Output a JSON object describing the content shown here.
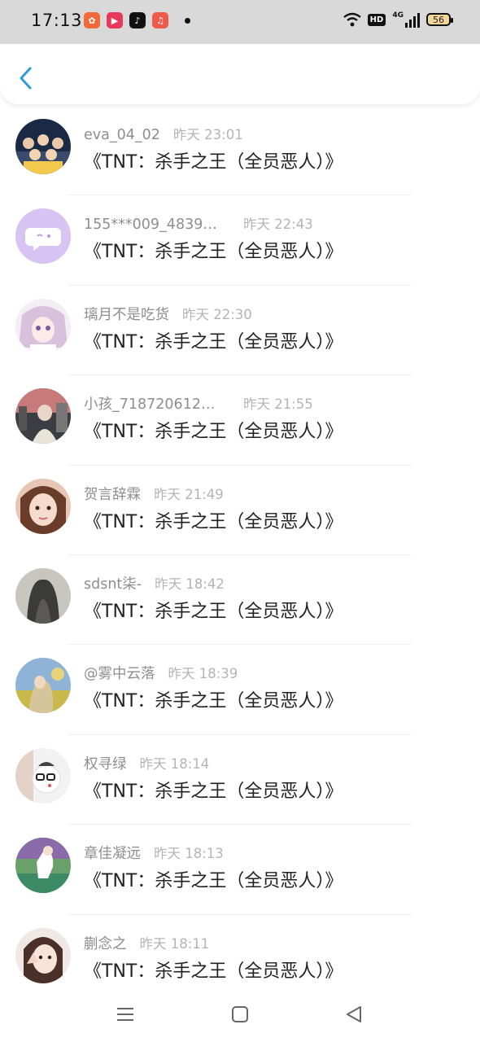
{
  "status_bar": {
    "time": "17:13",
    "network_badge": "HD",
    "signal_label": "4G",
    "battery": "56"
  },
  "header": {
    "back_icon": "chevron-left-icon",
    "accent_color": "#2f9be0"
  },
  "items": [
    {
      "name": "eva_04_02",
      "time": "昨天 23:01",
      "content": "《TNT：杀手之王（全员恶人）》"
    },
    {
      "name": "155***009_48390…",
      "time": "昨天 22:43",
      "content": "《TNT：杀手之王（全员恶人）》"
    },
    {
      "name": "璃月不是吃货",
      "time": "昨天 22:30",
      "content": "《TNT：杀手之王（全员恶人）》"
    },
    {
      "name": "小孩_7187206124…",
      "time": "昨天 21:55",
      "content": "《TNT：杀手之王（全员恶人）》"
    },
    {
      "name": "贺言辞霖",
      "time": "昨天 21:49",
      "content": "《TNT：杀手之王（全员恶人）》"
    },
    {
      "name": "sdsnt柒-",
      "time": "昨天 18:42",
      "content": "《TNT：杀手之王（全员恶人）》"
    },
    {
      "name": "@雾中云落",
      "time": "昨天 18:39",
      "content": "《TNT：杀手之王（全员恶人）》"
    },
    {
      "name": "权寻绿",
      "time": "昨天 18:14",
      "content": "《TNT：杀手之王（全员恶人）》"
    },
    {
      "name": "章佳凝远",
      "time": "昨天 18:13",
      "content": "《TNT：杀手之王（全员恶人）》"
    },
    {
      "name": "蒯念之",
      "time": "昨天 18:11",
      "content": "《TNT：杀手之王（全员恶人）》"
    }
  ],
  "nav_bar": {
    "icons": [
      "menu-icon",
      "home-square-icon",
      "back-triangle-icon"
    ]
  }
}
